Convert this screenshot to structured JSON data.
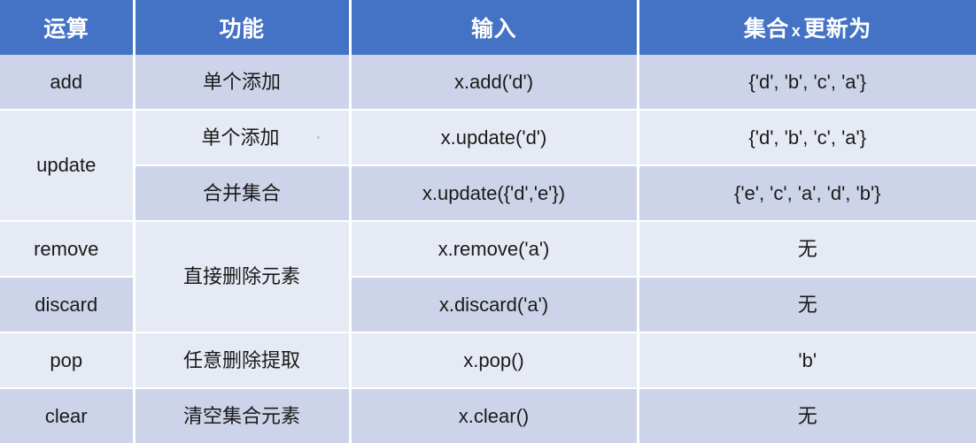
{
  "table": {
    "name": "python-set-operations-table",
    "colors": {
      "header_bg": "#4472C4",
      "header_text": "#FFFFFF",
      "row_dark": "#CDD4E9",
      "row_light": "#E6EAF4",
      "grid_line": "#FFFFFF",
      "body_text": "#1A1A1A"
    },
    "headers": {
      "operation": "运算",
      "function": "功能",
      "input": "输入",
      "result_prefix": "集合",
      "result_var": "x",
      "result_suffix": "更新为"
    },
    "rows": [
      {
        "operation": "add",
        "operation_rowspan": 1,
        "function": "单个添加",
        "function_rowspan": 1,
        "input": "x.add('d')",
        "result": "{'d', 'b', 'c', 'a'}",
        "stripe": "dark"
      },
      {
        "operation": "update",
        "operation_rowspan": 2,
        "function": "单个添加",
        "function_rowspan": 1,
        "input": "x.update('d')",
        "result": "{'d', 'b', 'c', 'a'}",
        "stripe": "light"
      },
      {
        "operation": null,
        "operation_rowspan": 0,
        "function": "合并集合",
        "function_rowspan": 1,
        "input": "x.update({'d','e'})",
        "result": "{'e', 'c', 'a', 'd', 'b'}",
        "stripe": "dark"
      },
      {
        "operation": "remove",
        "operation_rowspan": 1,
        "function": "直接删除元素",
        "function_rowspan": 2,
        "input": "x.remove('a')",
        "result": "无",
        "stripe": "light"
      },
      {
        "operation": "discard",
        "operation_rowspan": 1,
        "function": null,
        "function_rowspan": 0,
        "input": "x.discard('a')",
        "result": "无",
        "stripe": "dark"
      },
      {
        "operation": "pop",
        "operation_rowspan": 1,
        "function": "任意删除提取",
        "function_rowspan": 1,
        "input": "x.pop()",
        "result": "'b'",
        "stripe": "light"
      },
      {
        "operation": "clear",
        "operation_rowspan": 1,
        "function": "清空集合元素",
        "function_rowspan": 1,
        "input": "x.clear()",
        "result": "无",
        "stripe": "dark"
      }
    ]
  }
}
